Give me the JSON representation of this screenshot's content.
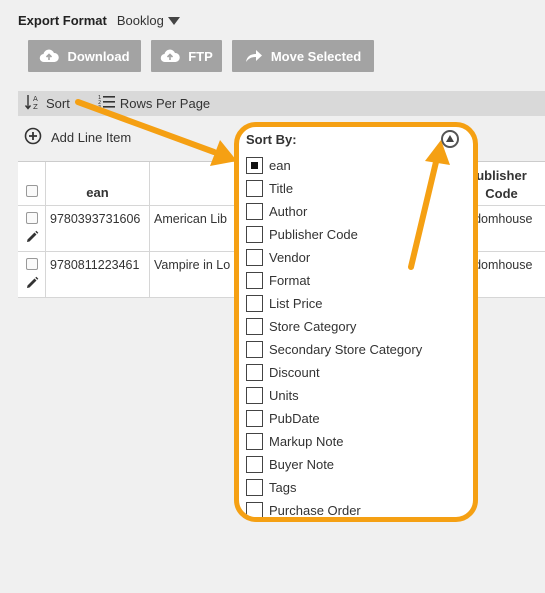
{
  "export": {
    "label": "Export Format",
    "value": "Booklog"
  },
  "actions": {
    "download": "Download",
    "ftp": "FTP",
    "move": "Move Selected"
  },
  "toolbar": {
    "sort": "Sort",
    "rows_per_page": "Rows Per Page"
  },
  "add_line_item": "Add Line Item",
  "table": {
    "headers": {
      "ean": "ean",
      "publisher_code_line1": "ublisher",
      "publisher_code_line2": "Code"
    },
    "rows": [
      {
        "ean": "9780393731606",
        "title": "American Lib",
        "publisher_code": "randomhouse"
      },
      {
        "ean": "9780811223461",
        "title": "Vampire in Lo",
        "publisher_code": "randomhouse"
      }
    ]
  },
  "sort_dropdown": {
    "title": "Sort By:",
    "options": [
      {
        "label": "ean",
        "checked": true
      },
      {
        "label": "Title",
        "checked": false
      },
      {
        "label": "Author",
        "checked": false
      },
      {
        "label": "Publisher Code",
        "checked": false
      },
      {
        "label": "Vendor",
        "checked": false
      },
      {
        "label": "Format",
        "checked": false
      },
      {
        "label": "List Price",
        "checked": false
      },
      {
        "label": "Store Category",
        "checked": false
      },
      {
        "label": "Secondary Store Category",
        "checked": false
      },
      {
        "label": "Discount",
        "checked": false
      },
      {
        "label": "Units",
        "checked": false
      },
      {
        "label": "PubDate",
        "checked": false
      },
      {
        "label": "Markup Note",
        "checked": false
      },
      {
        "label": "Buyer Note",
        "checked": false
      },
      {
        "label": "Tags",
        "checked": false
      },
      {
        "label": "Purchase Order",
        "checked": false
      }
    ]
  },
  "colors": {
    "highlight": "#f5a013",
    "button": "#a3a3a3",
    "toolbar": "#d9d9d9"
  },
  "icons": [
    "caret-down-icon",
    "cloud-upload-icon",
    "share-arrow-icon",
    "sort-az-icon",
    "list-numbered-icon",
    "plus-circle-icon",
    "pencil-icon",
    "collapse-up-icon"
  ]
}
